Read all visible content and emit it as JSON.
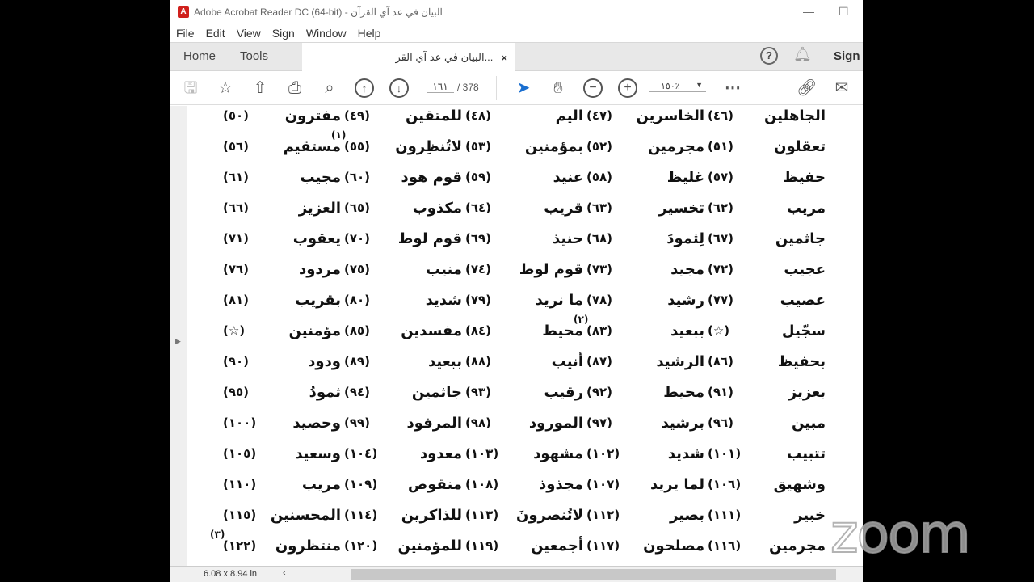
{
  "window": {
    "title": "البيان في عد آي القرآن - Adobe Acrobat Reader DC (64-bit)",
    "minimize": "—",
    "maximize": "☐"
  },
  "menu": [
    "File",
    "Edit",
    "View",
    "Sign",
    "Window",
    "Help"
  ],
  "tabs": {
    "home": "Home",
    "tools": "Tools",
    "doc": "البيان في عد آي القر...",
    "close": "×",
    "sign": "Sign"
  },
  "toolbar": {
    "page_current": "١٦١",
    "page_total": "/ 378",
    "zoom": "١٥٠٪"
  },
  "status": {
    "page_size": "6.08 x 8.94 in"
  },
  "overlay": {
    "logo": "zoom"
  },
  "rows": [
    [
      {
        "w": "الجاهلين",
        "n": "(٤٦)"
      },
      {
        "w": "الخاسرين",
        "n": "(٤٧)"
      },
      {
        "w": "اليم",
        "n": "(٤٨)"
      },
      {
        "w": "للمتقين",
        "n": "(٤٩)"
      },
      {
        "w": "مفترون",
        "n": "(٥٠)"
      }
    ],
    [
      {
        "w": "تعقلون",
        "n": "(٥١)"
      },
      {
        "w": "مجرمين",
        "n": "(٥٢)"
      },
      {
        "w": "بمؤمنين",
        "n": "(٥٣)"
      },
      {
        "w": "لاتُنظِرون",
        "n": "(٥٥)",
        "f": "(١)"
      },
      {
        "w": "مستقيم",
        "n": "(٥٦)"
      }
    ],
    [
      {
        "w": "حفيظ",
        "n": "(٥٧)"
      },
      {
        "w": "غليظ",
        "n": "(٥٨)"
      },
      {
        "w": "عنيد",
        "n": "(٥٩)"
      },
      {
        "w": "قوم هود",
        "n": "(٦٠)"
      },
      {
        "w": "مجيب",
        "n": "(٦١)"
      }
    ],
    [
      {
        "w": "مريب",
        "n": "(٦٢)"
      },
      {
        "w": "تخسير",
        "n": "(٦٣)"
      },
      {
        "w": "قريب",
        "n": "(٦٤)"
      },
      {
        "w": "مكذوب",
        "n": "(٦٥)"
      },
      {
        "w": "العزيز",
        "n": "(٦٦)"
      }
    ],
    [
      {
        "w": "جاثمين",
        "n": "(٦٧)"
      },
      {
        "w": "لِثمودَ",
        "n": "(٦٨)"
      },
      {
        "w": "حنيذ",
        "n": "(٦٩)"
      },
      {
        "w": "قوم لوط",
        "n": "(٧٠)"
      },
      {
        "w": "يعقوب",
        "n": "(٧١)"
      }
    ],
    [
      {
        "w": "عجيب",
        "n": "(٧٢)"
      },
      {
        "w": "مجيد",
        "n": "(٧٣)"
      },
      {
        "w": "قوم لوط",
        "n": "(٧٤)"
      },
      {
        "w": "منيب",
        "n": "(٧٥)"
      },
      {
        "w": "مردود",
        "n": "(٧٦)"
      }
    ],
    [
      {
        "w": "عصيب",
        "n": "(٧٧)"
      },
      {
        "w": "رشيد",
        "n": "(٧٨)"
      },
      {
        "w": "ما نريد",
        "n": "(٧٩)"
      },
      {
        "w": "شديد",
        "n": "(٨٠)"
      },
      {
        "w": "بقريب",
        "n": "(٨١)"
      }
    ],
    [
      {
        "w": "سجّيل",
        "n": "(☆)"
      },
      {
        "w": "ببعيد",
        "n": "(٨٣)",
        "f": "(٢)"
      },
      {
        "w": "محيط",
        "n": "(٨٤)"
      },
      {
        "w": "مفسدين",
        "n": "(٨٥)"
      },
      {
        "w": "مؤمنين",
        "n": "(☆)"
      }
    ],
    [
      {
        "w": "بحفيظ",
        "n": "(٨٦)"
      },
      {
        "w": "الرشيد",
        "n": "(٨٧)"
      },
      {
        "w": "أنيب",
        "n": "(٨٨)"
      },
      {
        "w": "ببعيد",
        "n": "(٨٩)"
      },
      {
        "w": "ودود",
        "n": "(٩٠)"
      }
    ],
    [
      {
        "w": "بعزيز",
        "n": "(٩١)"
      },
      {
        "w": "محيط",
        "n": "(٩٢)"
      },
      {
        "w": "رقيب",
        "n": "(٩٣)"
      },
      {
        "w": "جاثمين",
        "n": "(٩٤)"
      },
      {
        "w": "ثمودُ",
        "n": "(٩٥)"
      }
    ],
    [
      {
        "w": "مبين",
        "n": "(٩٦)"
      },
      {
        "w": "برشيد",
        "n": "(٩٧)"
      },
      {
        "w": "المورود",
        "n": "(٩٨)"
      },
      {
        "w": "المرفود",
        "n": "(٩٩)"
      },
      {
        "w": "وحصيد",
        "n": "(١٠٠)"
      }
    ],
    [
      {
        "w": "تتبيب",
        "n": "(١٠١)"
      },
      {
        "w": "شديد",
        "n": "(١٠٢)"
      },
      {
        "w": "مشهود",
        "n": "(١٠٣)"
      },
      {
        "w": "معدود",
        "n": "(١٠٤)"
      },
      {
        "w": "وسعيد",
        "n": "(١٠٥)"
      }
    ],
    [
      {
        "w": "وشهيق",
        "n": "(١٠٦)"
      },
      {
        "w": "لما يريد",
        "n": "(١٠٧)"
      },
      {
        "w": "مجذوذ",
        "n": "(١٠٨)"
      },
      {
        "w": "منقوص",
        "n": "(١٠٩)"
      },
      {
        "w": "مريب",
        "n": "(١١٠)"
      }
    ],
    [
      {
        "w": "خبير",
        "n": "(١١١)"
      },
      {
        "w": "بصير",
        "n": "(١١٢)"
      },
      {
        "w": "لاتُنصرونَ",
        "n": "(١١٣)"
      },
      {
        "w": "للذاكرين",
        "n": "(١١٤)"
      },
      {
        "w": "المحسنين",
        "n": "(١١٥)"
      }
    ],
    [
      {
        "w": "مجرمين",
        "n": "(١١٦)"
      },
      {
        "w": "مصلحون",
        "n": "(١١٧)"
      },
      {
        "w": "أجمعين",
        "n": "(١١٩)"
      },
      {
        "w": "للمؤمنين",
        "n": "(١٢٠)"
      },
      {
        "w": "منتظرون",
        "n": "(١٢٢)",
        "f": "(٣)"
      }
    ]
  ]
}
